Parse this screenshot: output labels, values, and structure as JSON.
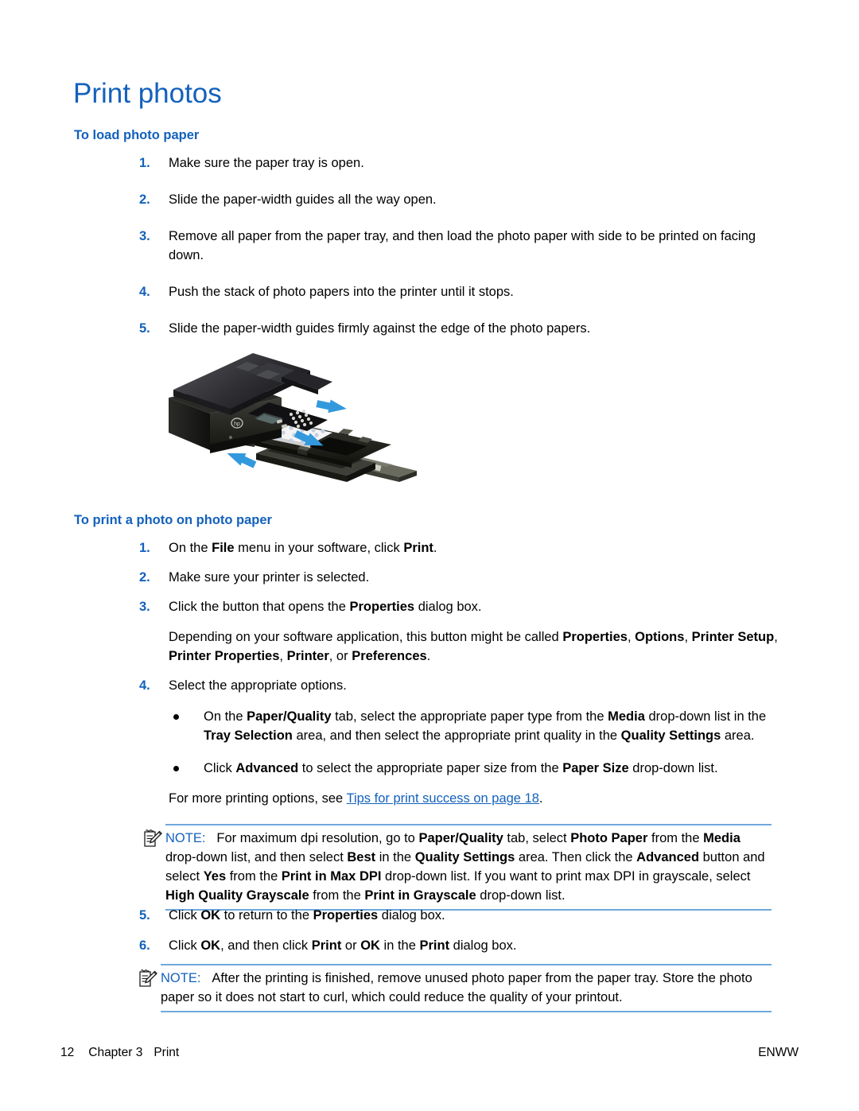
{
  "document": {
    "title": "Print photos",
    "sections": [
      {
        "id": "load",
        "heading": "To load photo paper",
        "steps": [
          "Make sure the paper tray is open.",
          "Slide the paper-width guides all the way open.",
          "Remove all paper from the paper tray, and then load the photo paper with side to be printed on facing down.",
          "Push the stack of photo papers into the printer until it stops.",
          "Slide the paper-width guides firmly against the edge of the photo papers."
        ],
        "numbers": [
          "1.",
          "2.",
          "3.",
          "4.",
          "5."
        ]
      },
      {
        "id": "print",
        "heading": "To print a photo on photo paper",
        "numbers": [
          "1.",
          "2.",
          "3.",
          "4.",
          "5.",
          "6."
        ],
        "step1": {
          "t1": "On the ",
          "b1": "File",
          "t2": " menu in your software, click ",
          "b2": "Print",
          "t3": "."
        },
        "step2": "Make sure your printer is selected.",
        "step3": {
          "t1": "Click the button that opens the ",
          "b1": "Properties",
          "t2": " dialog box."
        },
        "step3_note": {
          "t1": "Depending on your software application, this button might be called ",
          "b1": "Properties",
          "t2": ", ",
          "b2": "Options",
          "t3": ", ",
          "b3": "Printer Setup",
          "t4": ", ",
          "b4": "Printer Properties",
          "t5": ", ",
          "b5": "Printer",
          "t6": ", or ",
          "b6": "Preferences",
          "t7": "."
        },
        "step4": "Select the appropriate options.",
        "bullets": [
          {
            "t1": "On the ",
            "b1": "Paper/Quality",
            "t2": " tab, select the appropriate paper type from the ",
            "b2": "Media",
            "t3": " drop-down list in the ",
            "b3": "Tray Selection",
            "t4": " area, and then select the appropriate print quality in the ",
            "b4": "Quality Settings",
            "t5": " area."
          },
          {
            "t1": "Click ",
            "b1": "Advanced",
            "t2": " to select the appropriate paper size from the ",
            "b2": "Paper Size",
            "t3": " drop-down list."
          }
        ],
        "crossref": {
          "lead": "For more printing options, see ",
          "link": "Tips for print success on page 18",
          "tail": "."
        },
        "step5": {
          "t1": "Click ",
          "b1": "OK",
          "t2": " to return to the ",
          "b2": "Properties",
          "t3": " dialog box."
        },
        "step6": {
          "t1": "Click ",
          "b1": "OK",
          "t2": ", and then click ",
          "b2": "Print",
          "t3": " or ",
          "b3": "OK",
          "t4": " in the ",
          "b4": "Print",
          "t5": " dialog box."
        }
      }
    ],
    "notes": [
      {
        "id": "note-maxdpi",
        "label": "NOTE:",
        "icon": "note-pencil-icon",
        "t1": "For maximum dpi resolution, go to ",
        "b1": "Paper/Quality",
        "t2": " tab, select ",
        "b2": "Photo Paper",
        "t3": " from the ",
        "b3": "Media",
        "t4": " drop-down list, and then select ",
        "b4": "Best",
        "t5": " in the ",
        "b5": "Quality Settings",
        "t6": " area. Then click the ",
        "b6": "Advanced",
        "t7": " button and select ",
        "b7": "Yes",
        "t8": " from the ",
        "b8": "Print in Max DPI",
        "t9": " drop-down list. If you want to print max DPI in grayscale, select ",
        "b9": "High Quality Grayscale",
        "t10": " from the ",
        "b10": "Print in Grayscale",
        "t11": " drop-down list."
      },
      {
        "id": "note-storage",
        "label": "NOTE:",
        "icon": "note-pencil-icon",
        "t1": "After the printing is finished, remove unused photo paper from the paper tray. Store the photo paper so it does not start to curl, which could reduce the quality of your printout."
      }
    ],
    "figure": {
      "name": "printer-load-photo-paper-illustration",
      "alt": "Printer with paper tray extended, photo paper stack and three blue arrows"
    },
    "footer": {
      "page_number": "12",
      "chapter_label": "Chapter 3",
      "chapter_title": "Print",
      "locale": "ENWW"
    },
    "colors": {
      "heading_blue": "#1361BC",
      "link_blue": "#1361BC",
      "note_rule": "#6FA8DC",
      "arrow_blue": "#3399DD"
    }
  }
}
